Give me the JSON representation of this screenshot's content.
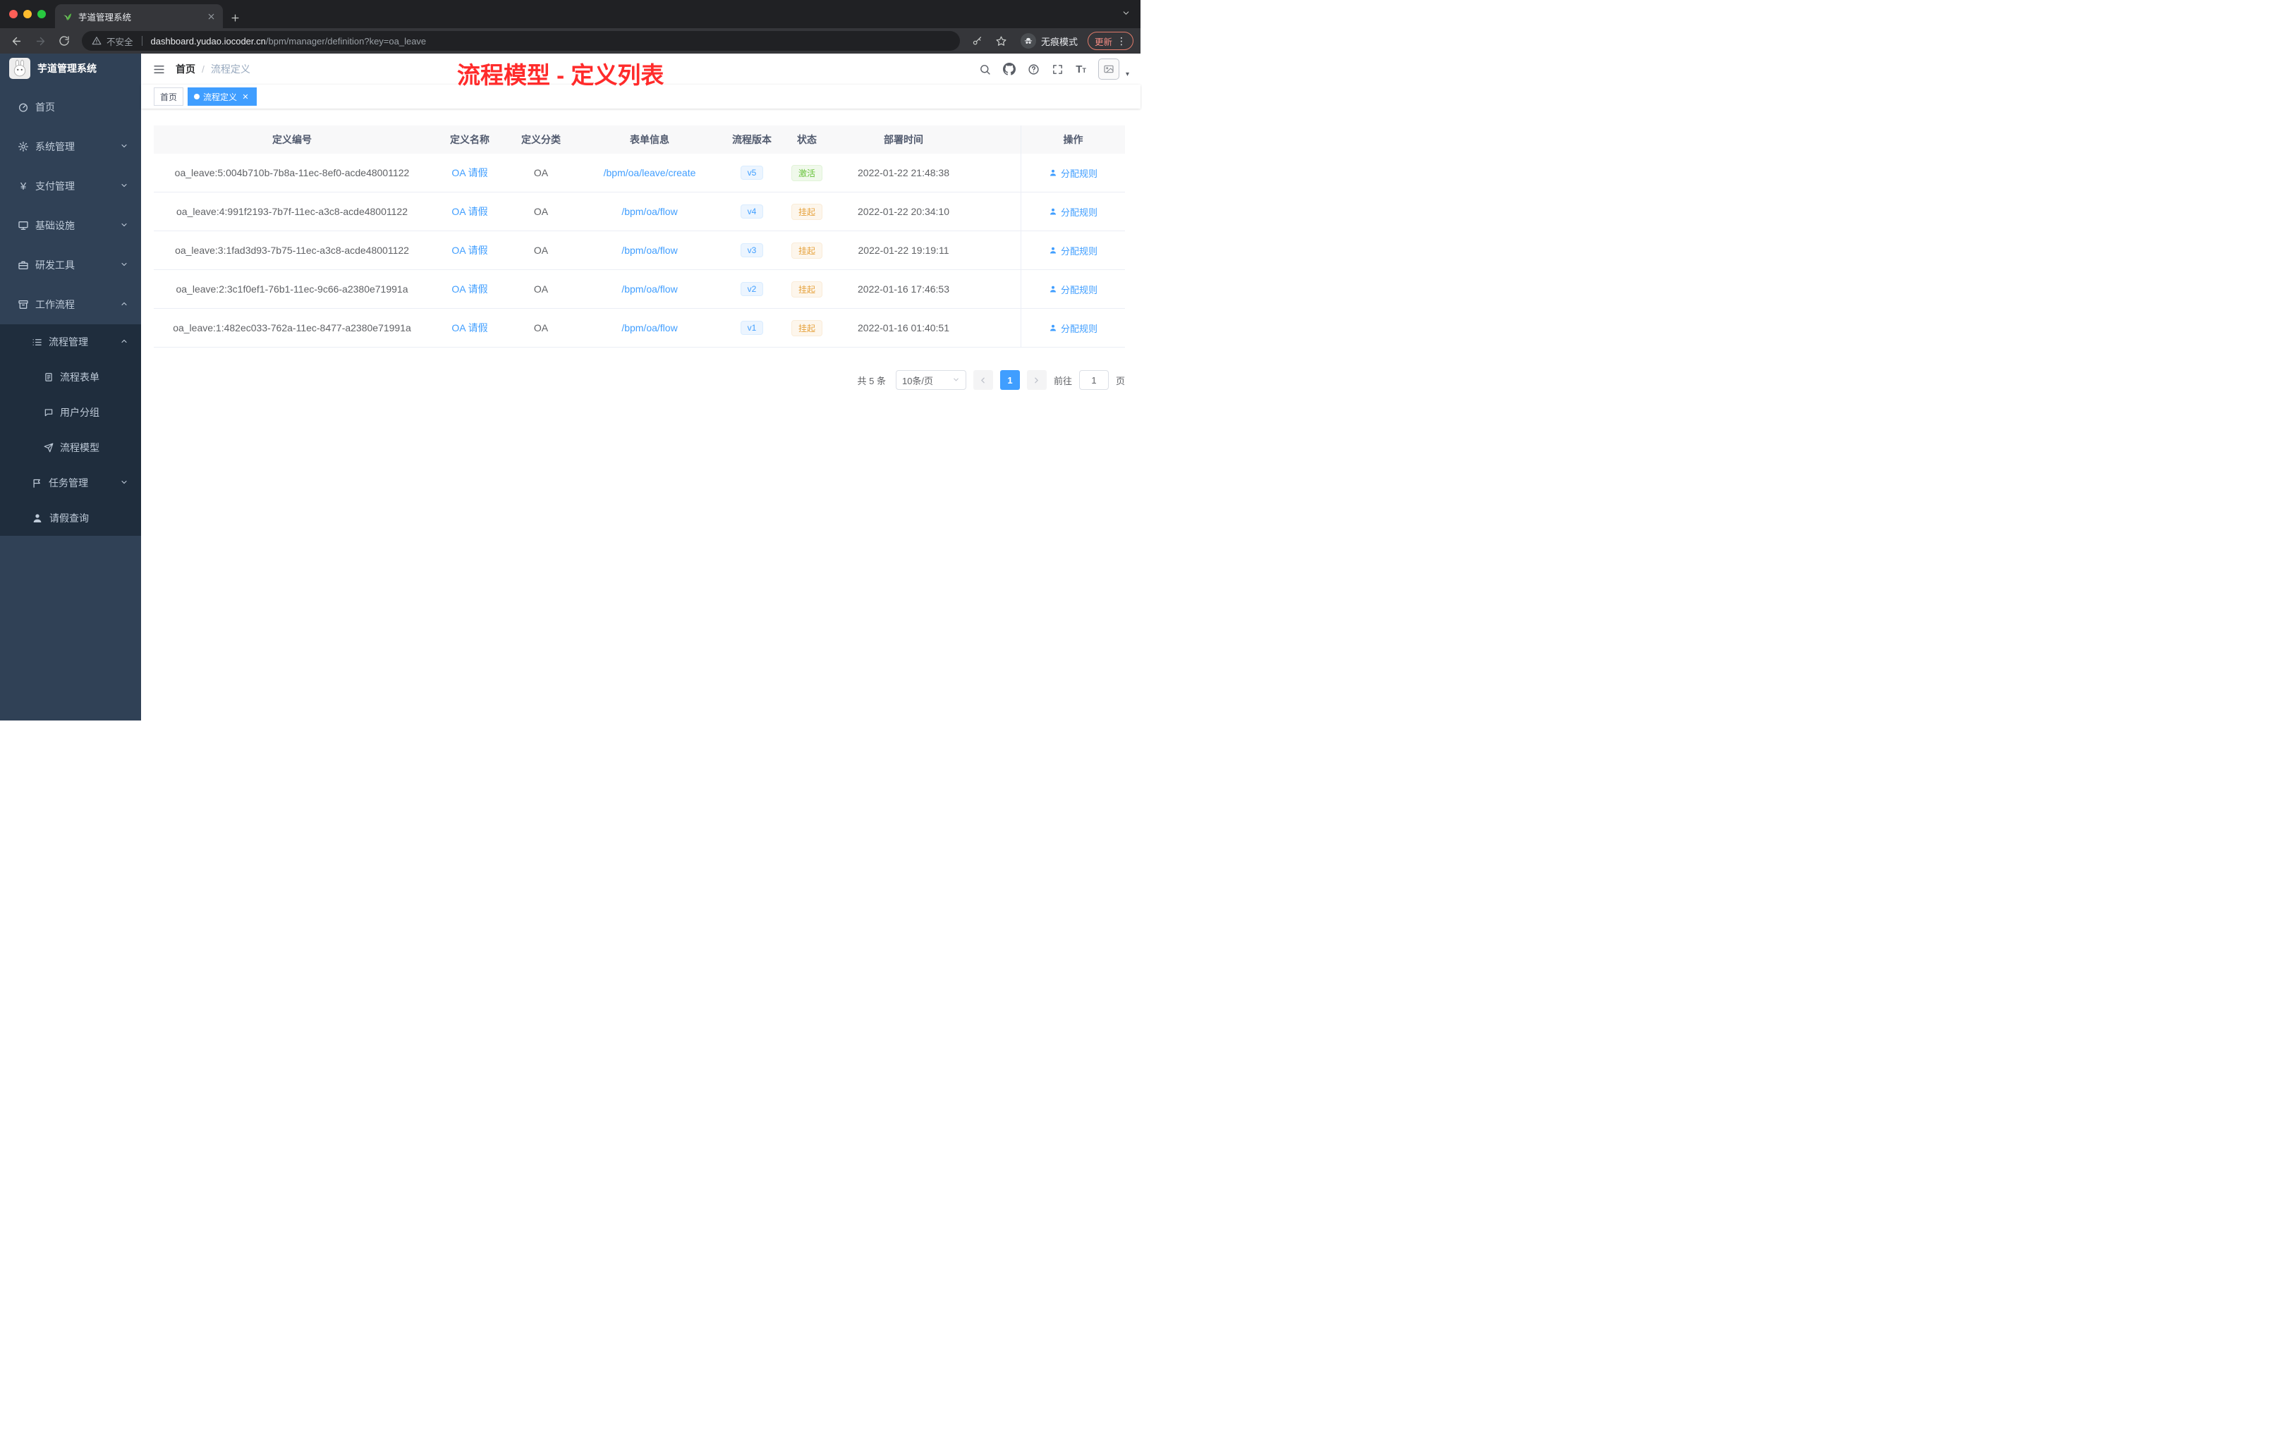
{
  "browser": {
    "tab_title": "芋道管理系统",
    "security_label": "不安全",
    "url_host": "dashboard.yudao.iocoder.cn",
    "url_path": "/bpm/manager/definition?key=oa_leave",
    "incognito_label": "无痕模式",
    "update_label": "更新"
  },
  "annotation": "流程模型 - 定义列表",
  "sidebar": {
    "title": "芋道管理系统",
    "items": {
      "home": "首页",
      "system": "系统管理",
      "payment": "支付管理",
      "infra": "基础设施",
      "devtools": "研发工具",
      "workflow": "工作流程",
      "process_mgmt": "流程管理",
      "process_form": "流程表单",
      "user_group": "用户分组",
      "process_model": "流程模型",
      "task_mgmt": "任务管理",
      "leave_query": "请假查询"
    }
  },
  "breadcrumb": {
    "root": "首页",
    "sep": "/",
    "current": "流程定义"
  },
  "tags": {
    "home": "首页",
    "active": "流程定义"
  },
  "table": {
    "columns": {
      "id": "定义编号",
      "name": "定义名称",
      "category": "定义分类",
      "form": "表单信息",
      "version": "流程版本",
      "status": "状态",
      "time": "部署时间",
      "action": "操作"
    },
    "rows": [
      {
        "id": "oa_leave:5:004b710b-7b8a-11ec-8ef0-acde48001122",
        "name": "OA 请假",
        "category": "OA",
        "form": "/bpm/oa/leave/create",
        "version": "v5",
        "status": "激活",
        "status_type": "success",
        "time": "2022-01-22 21:48:38",
        "action": "分配规则"
      },
      {
        "id": "oa_leave:4:991f2193-7b7f-11ec-a3c8-acde48001122",
        "name": "OA 请假",
        "category": "OA",
        "form": "/bpm/oa/flow",
        "version": "v4",
        "status": "挂起",
        "status_type": "warning",
        "time": "2022-01-22 20:34:10",
        "action": "分配规则"
      },
      {
        "id": "oa_leave:3:1fad3d93-7b75-11ec-a3c8-acde48001122",
        "name": "OA 请假",
        "category": "OA",
        "form": "/bpm/oa/flow",
        "version": "v3",
        "status": "挂起",
        "status_type": "warning",
        "time": "2022-01-22 19:19:11",
        "action": "分配规则"
      },
      {
        "id": "oa_leave:2:3c1f0ef1-76b1-11ec-9c66-a2380e71991a",
        "name": "OA 请假",
        "category": "OA",
        "form": "/bpm/oa/flow",
        "version": "v2",
        "status": "挂起",
        "status_type": "warning",
        "time": "2022-01-16 17:46:53",
        "action": "分配规则"
      },
      {
        "id": "oa_leave:1:482ec033-762a-11ec-8477-a2380e71991a",
        "name": "OA 请假",
        "category": "OA",
        "form": "/bpm/oa/flow",
        "version": "v1",
        "status": "挂起",
        "status_type": "warning",
        "time": "2022-01-16 01:40:51",
        "action": "分配规则"
      }
    ]
  },
  "pagination": {
    "total": "共 5 条",
    "page_size": "10条/页",
    "page": "1",
    "goto_label": "前往",
    "goto_value": "1",
    "unit_label": "页"
  },
  "colors": {
    "accent": "#409EFF",
    "success": "#67C23A",
    "warning": "#E6A23C",
    "annotation_red": "#FF2B2B",
    "sidebar_bg": "#304156",
    "submenu_bg": "#1F2D3D"
  }
}
